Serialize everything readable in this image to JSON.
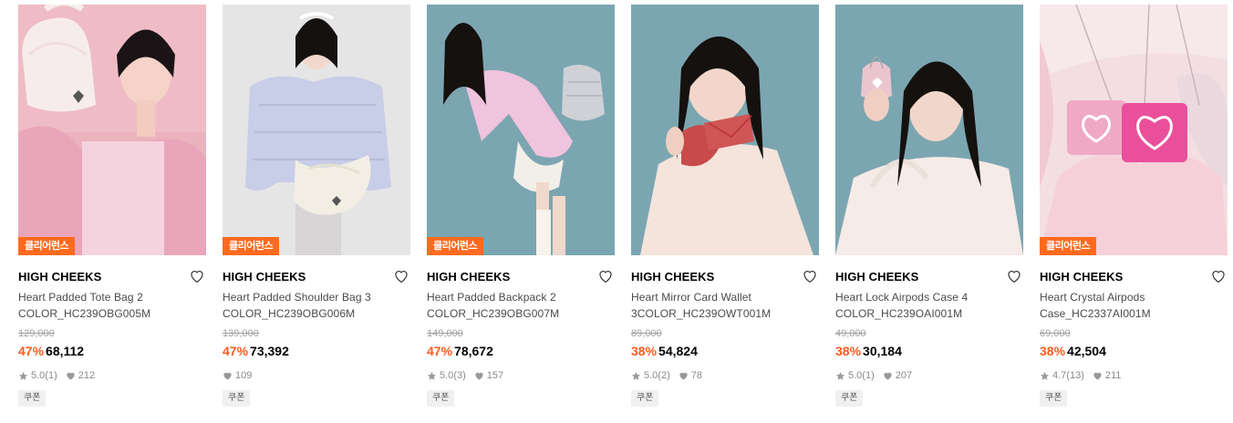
{
  "colors": {
    "accent": "#ff5a1f",
    "badge": "#ff6a1f"
  },
  "products": [
    {
      "badge": "클리어런스",
      "brand": "HIGH CHEEKS",
      "name1": "Heart Padded Tote Bag 2",
      "name2": "COLOR_HC239OBG005M",
      "original": "129,000",
      "discount": "47%",
      "price": "68,112",
      "rating": "5.0",
      "reviews": "(1)",
      "likes": "212",
      "coupon": "쿠폰",
      "photo": "model-pink-background-white-heart-tote"
    },
    {
      "badge": "클리어런스",
      "brand": "HIGH CHEEKS",
      "name1": "Heart Padded Shoulder Bag 3",
      "name2": "COLOR_HC239OBG006M",
      "original": "139,000",
      "discount": "47%",
      "price": "73,392",
      "rating": "",
      "reviews": "",
      "likes": "109",
      "coupon": "쿠폰",
      "photo": "model-lavender-puffer-cream-shoulder-bag"
    },
    {
      "badge": "클리어런스",
      "brand": "HIGH CHEEKS",
      "name1": "Heart Padded Backpack 2",
      "name2": "COLOR_HC239OBG007M",
      "original": "149,000",
      "discount": "47%",
      "price": "78,672",
      "rating": "5.0",
      "reviews": "(3)",
      "likes": "157",
      "coupon": "쿠폰",
      "photo": "model-teal-background-silver-backpack"
    },
    {
      "badge": "",
      "brand": "HIGH CHEEKS",
      "name1": "Heart Mirror Card Wallet",
      "name2": "3COLOR_HC239OWT001M",
      "original": "89,000",
      "discount": "38%",
      "price": "54,824",
      "rating": "5.0",
      "reviews": "(2)",
      "likes": "78",
      "coupon": "쿠폰",
      "photo": "model-teal-background-red-wallet"
    },
    {
      "badge": "",
      "brand": "HIGH CHEEKS",
      "name1": "Heart Lock Airpods Case 4",
      "name2": "COLOR_HC239OAI001M",
      "original": "49,000",
      "discount": "38%",
      "price": "30,184",
      "rating": "5.0",
      "reviews": "(1)",
      "likes": "207",
      "coupon": "쿠폰",
      "photo": "model-teal-background-pink-airpods-case"
    },
    {
      "badge": "클리어런스",
      "brand": "HIGH CHEEKS",
      "name1": "Heart Crystal Airpods",
      "name2": "Case_HC2337AI001M",
      "original": "69,000",
      "discount": "38%",
      "price": "42,504",
      "rating": "4.7",
      "reviews": "(13)",
      "likes": "211",
      "coupon": "쿠폰",
      "photo": "pink-fur-crystal-heart-airpods-cases"
    }
  ]
}
